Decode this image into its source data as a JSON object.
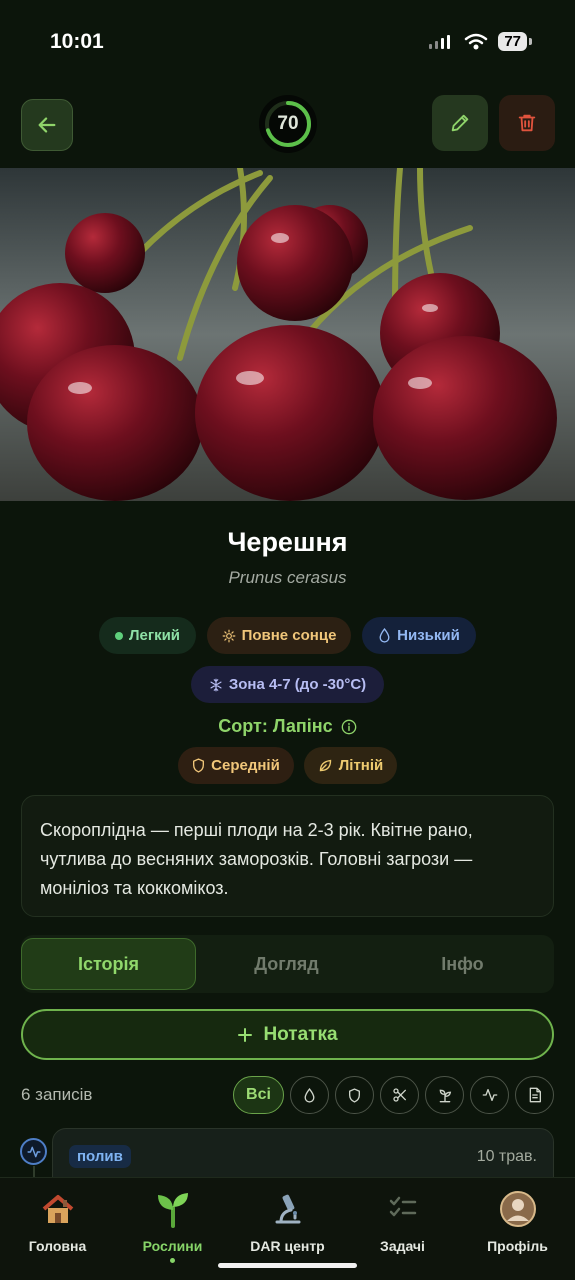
{
  "status_bar": {
    "time": "10:01",
    "battery": "77"
  },
  "header": {
    "health_score": "70",
    "health_fraction": 0.7
  },
  "plant": {
    "name": "Черешня",
    "latin_name": "Prunus cerasus",
    "tags": {
      "difficulty": "Легкий",
      "sun": "Повне сонце",
      "water": "Низький",
      "zone": "Зона 4-7 (до -30°C)"
    },
    "variety": "Сорт: Лапінс",
    "sub_tags": {
      "resistance": "Середній",
      "season": "Літній"
    },
    "description": "Скороплідна — перші плоди на 2-3 рік. Квітне рано, чутлива до весняних заморозків. Головні загрози — моніліоз та коккомікоз."
  },
  "tabs": [
    {
      "label": "Історія",
      "active": true
    },
    {
      "label": "Догляд",
      "active": false
    },
    {
      "label": "Інфо",
      "active": false
    }
  ],
  "add_note_label": "Нотатка",
  "records": {
    "count_label": "6 записів",
    "filter_all_label": "Всі",
    "filters": [
      "water-drop-icon",
      "shield-icon",
      "scissors-icon",
      "sprout-icon",
      "activity-icon",
      "document-icon"
    ]
  },
  "entries": [
    {
      "badge": "полив",
      "date": "10 трав."
    }
  ],
  "nav": [
    {
      "label": "Головна",
      "icon": "house-icon",
      "active": false
    },
    {
      "label": "Рослини",
      "icon": "sprout-icon",
      "active": true
    },
    {
      "label": "DAR центр",
      "icon": "microscope-icon",
      "active": false
    },
    {
      "label": "Задачі",
      "icon": "checklist-icon",
      "active": false
    },
    {
      "label": "Профіль",
      "icon": "avatar",
      "active": false
    }
  ],
  "colors": {
    "accent": "#8fd46a",
    "background": "#0c150b",
    "danger": "#e0533d"
  }
}
